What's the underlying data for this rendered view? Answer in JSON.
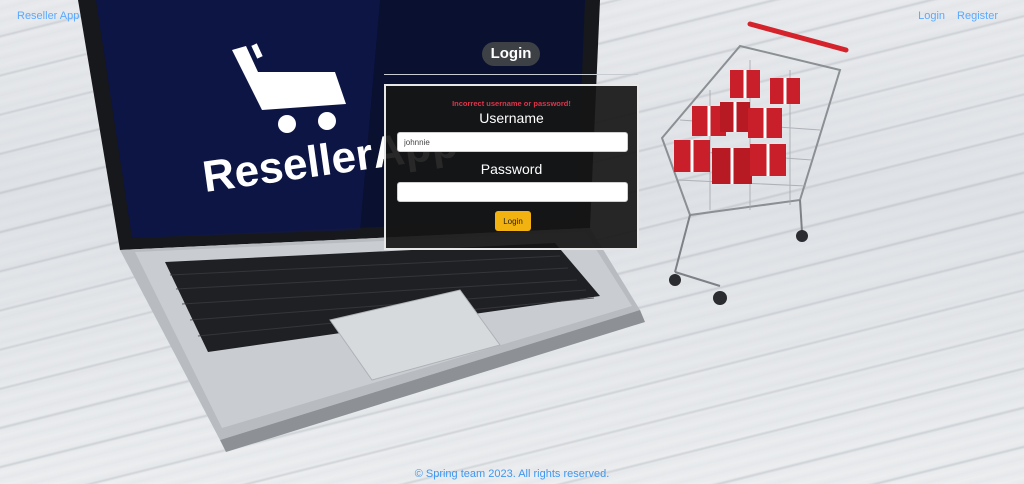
{
  "navbar": {
    "brand": "Reseller App",
    "links": [
      {
        "label": "Login"
      },
      {
        "label": "Register"
      }
    ]
  },
  "login": {
    "title": "Login",
    "error_message": "Incorrect username or password!",
    "username_label": "Username",
    "username_value": "johnnie",
    "password_label": "Password",
    "password_value": "",
    "submit_label": "Login"
  },
  "background": {
    "laptop_screen_text": "ResellerApp"
  },
  "footer": {
    "text": "© Spring team 2023. All rights reserved."
  },
  "colors": {
    "link": "#5aa9ff",
    "error": "#e0344b",
    "submit": "#f2b310",
    "card": "#161616"
  }
}
